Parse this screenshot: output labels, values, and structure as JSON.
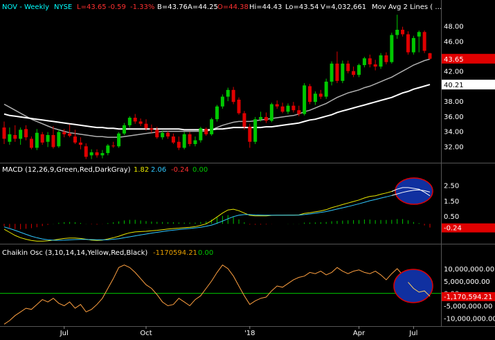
{
  "chart_data": [
    {
      "type": "candlestick",
      "panel": "price",
      "header": {
        "symbol": "NOV - Weekly",
        "exchange": "NYSE",
        "last": "L=43.65",
        "change": "-0.59",
        "change_pct": "-1.33%",
        "bid": "B=43.76",
        "ask": "A=44.25",
        "open": "O=44.38",
        "high": "Hi=44.43",
        "low": "Lo=43.54",
        "volume": "V=4,032,661",
        "study": "Mov Avg 2 Lines ( ..."
      },
      "y_ticks": [
        "48.00",
        "46.00",
        "44.00",
        "42.00",
        "40.00",
        "38.00",
        "36.00",
        "34.00",
        "32.00"
      ],
      "ylim": [
        30,
        49.8
      ],
      "price_tag": "43.65",
      "ma_tag": "40.21",
      "x_labels": [
        "Jul",
        "Oct",
        "'18",
        "Apr",
        "Jul"
      ],
      "candles": [
        {
          "o": 34.5,
          "h": 35.3,
          "l": 32.3,
          "c": 33.0
        },
        {
          "o": 32.6,
          "h": 34.5,
          "l": 32.2,
          "c": 33.6
        },
        {
          "o": 33.5,
          "h": 34.8,
          "l": 32.6,
          "c": 33.0
        },
        {
          "o": 33.0,
          "h": 34.5,
          "l": 32.2,
          "c": 34.2
        },
        {
          "o": 34.3,
          "h": 34.8,
          "l": 32.8,
          "c": 33.2
        },
        {
          "o": 33.0,
          "h": 33.3,
          "l": 31.6,
          "c": 31.8
        },
        {
          "o": 31.8,
          "h": 34.3,
          "l": 31.5,
          "c": 33.8
        },
        {
          "o": 33.6,
          "h": 33.9,
          "l": 32.2,
          "c": 32.5
        },
        {
          "o": 32.6,
          "h": 33.9,
          "l": 31.9,
          "c": 33.5
        },
        {
          "o": 33.5,
          "h": 34.7,
          "l": 31.7,
          "c": 31.9
        },
        {
          "o": 32.0,
          "h": 34.2,
          "l": 31.8,
          "c": 33.9
        },
        {
          "o": 33.9,
          "h": 34.3,
          "l": 33.2,
          "c": 33.6
        },
        {
          "o": 33.7,
          "h": 34.9,
          "l": 33.2,
          "c": 33.4
        },
        {
          "o": 33.3,
          "h": 34.2,
          "l": 32.3,
          "c": 32.5
        },
        {
          "o": 32.5,
          "h": 33.2,
          "l": 31.6,
          "c": 32.2
        },
        {
          "o": 32.0,
          "h": 32.4,
          "l": 30.3,
          "c": 30.6
        },
        {
          "o": 30.8,
          "h": 31.6,
          "l": 30.3,
          "c": 31.2
        },
        {
          "o": 31.2,
          "h": 31.6,
          "l": 30.5,
          "c": 30.8
        },
        {
          "o": 30.8,
          "h": 31.5,
          "l": 30.4,
          "c": 31.1
        },
        {
          "o": 31.1,
          "h": 32.3,
          "l": 30.8,
          "c": 32.1
        },
        {
          "o": 32.1,
          "h": 32.6,
          "l": 31.8,
          "c": 32.0
        },
        {
          "o": 32.0,
          "h": 33.9,
          "l": 31.8,
          "c": 33.7
        },
        {
          "o": 33.7,
          "h": 35.1,
          "l": 33.5,
          "c": 34.8
        },
        {
          "o": 34.8,
          "h": 36.0,
          "l": 34.5,
          "c": 35.8
        },
        {
          "o": 35.8,
          "h": 36.3,
          "l": 35.0,
          "c": 35.3
        },
        {
          "o": 35.3,
          "h": 35.7,
          "l": 34.7,
          "c": 35.0
        },
        {
          "o": 35.0,
          "h": 35.6,
          "l": 34.1,
          "c": 34.4
        },
        {
          "o": 34.4,
          "h": 34.9,
          "l": 33.8,
          "c": 34.2
        },
        {
          "o": 34.2,
          "h": 34.6,
          "l": 33.0,
          "c": 33.2
        },
        {
          "o": 33.2,
          "h": 34.1,
          "l": 32.9,
          "c": 33.8
        },
        {
          "o": 33.8,
          "h": 34.0,
          "l": 33.0,
          "c": 33.3
        },
        {
          "o": 33.3,
          "h": 33.7,
          "l": 32.3,
          "c": 32.5
        },
        {
          "o": 32.6,
          "h": 33.3,
          "l": 31.5,
          "c": 31.8
        },
        {
          "o": 31.8,
          "h": 33.9,
          "l": 31.6,
          "c": 33.6
        },
        {
          "o": 33.6,
          "h": 33.9,
          "l": 32.0,
          "c": 32.3
        },
        {
          "o": 32.3,
          "h": 33.3,
          "l": 32.0,
          "c": 32.8
        },
        {
          "o": 32.8,
          "h": 34.6,
          "l": 32.5,
          "c": 34.4
        },
        {
          "o": 34.3,
          "h": 34.5,
          "l": 33.4,
          "c": 33.6
        },
        {
          "o": 33.6,
          "h": 35.8,
          "l": 33.4,
          "c": 35.6
        },
        {
          "o": 35.6,
          "h": 37.5,
          "l": 35.3,
          "c": 37.3
        },
        {
          "o": 37.3,
          "h": 38.9,
          "l": 37.0,
          "c": 38.6
        },
        {
          "o": 38.6,
          "h": 39.8,
          "l": 38.0,
          "c": 39.5
        },
        {
          "o": 39.5,
          "h": 39.9,
          "l": 37.6,
          "c": 37.9
        },
        {
          "o": 38.2,
          "h": 38.5,
          "l": 36.2,
          "c": 36.4
        },
        {
          "o": 36.4,
          "h": 36.7,
          "l": 34.2,
          "c": 34.6
        },
        {
          "o": 34.6,
          "h": 35.0,
          "l": 31.8,
          "c": 32.6
        },
        {
          "o": 32.6,
          "h": 35.9,
          "l": 32.3,
          "c": 35.6
        },
        {
          "o": 35.6,
          "h": 36.6,
          "l": 35.3,
          "c": 35.9
        },
        {
          "o": 35.9,
          "h": 36.5,
          "l": 35.1,
          "c": 35.4
        },
        {
          "o": 35.4,
          "h": 37.8,
          "l": 35.2,
          "c": 37.6
        },
        {
          "o": 37.6,
          "h": 38.1,
          "l": 37.0,
          "c": 37.3
        },
        {
          "o": 37.3,
          "h": 37.8,
          "l": 36.4,
          "c": 36.6
        },
        {
          "o": 36.6,
          "h": 37.7,
          "l": 36.3,
          "c": 37.4
        },
        {
          "o": 37.4,
          "h": 37.9,
          "l": 36.5,
          "c": 36.8
        },
        {
          "o": 36.8,
          "h": 37.4,
          "l": 36.0,
          "c": 36.3
        },
        {
          "o": 36.3,
          "h": 40.4,
          "l": 36.1,
          "c": 40.1
        },
        {
          "o": 40.0,
          "h": 40.3,
          "l": 37.6,
          "c": 37.9
        },
        {
          "o": 37.9,
          "h": 39.3,
          "l": 37.5,
          "c": 39.0
        },
        {
          "o": 39.0,
          "h": 39.5,
          "l": 38.3,
          "c": 38.6
        },
        {
          "o": 38.6,
          "h": 41.0,
          "l": 38.3,
          "c": 40.6
        },
        {
          "o": 40.6,
          "h": 43.3,
          "l": 40.1,
          "c": 43.0
        },
        {
          "o": 43.0,
          "h": 44.6,
          "l": 40.4,
          "c": 40.7
        },
        {
          "o": 40.7,
          "h": 43.4,
          "l": 40.4,
          "c": 43.0
        },
        {
          "o": 43.0,
          "h": 43.4,
          "l": 41.7,
          "c": 42.0
        },
        {
          "o": 42.0,
          "h": 42.6,
          "l": 41.2,
          "c": 41.5
        },
        {
          "o": 41.5,
          "h": 43.0,
          "l": 41.2,
          "c": 42.8
        },
        {
          "o": 42.8,
          "h": 43.9,
          "l": 42.5,
          "c": 43.7
        },
        {
          "o": 43.7,
          "h": 44.2,
          "l": 42.5,
          "c": 42.9
        },
        {
          "o": 42.9,
          "h": 43.5,
          "l": 42.1,
          "c": 42.6
        },
        {
          "o": 42.6,
          "h": 44.4,
          "l": 42.3,
          "c": 44.1
        },
        {
          "o": 44.1,
          "h": 44.5,
          "l": 42.9,
          "c": 43.2
        },
        {
          "o": 43.2,
          "h": 47.1,
          "l": 43.0,
          "c": 46.8
        },
        {
          "o": 46.8,
          "h": 49.5,
          "l": 46.3,
          "c": 47.5
        },
        {
          "o": 47.5,
          "h": 47.9,
          "l": 46.6,
          "c": 46.9
        },
        {
          "o": 46.9,
          "h": 47.3,
          "l": 44.2,
          "c": 44.5
        },
        {
          "o": 44.5,
          "h": 46.7,
          "l": 44.2,
          "c": 46.4
        },
        {
          "o": 46.6,
          "h": 47.4,
          "l": 44.5,
          "c": 47.2
        },
        {
          "o": 47.2,
          "h": 47.4,
          "l": 44.4,
          "c": 44.7
        },
        {
          "o": 44.38,
          "h": 44.43,
          "l": 43.54,
          "c": 43.65
        }
      ],
      "series": [
        {
          "name": "MA1",
          "color": "#b0b0b0",
          "values": [
            37.6,
            37.2,
            36.8,
            36.4,
            36.0,
            35.6,
            35.3,
            35.0,
            34.7,
            34.4,
            34.2,
            34.0,
            33.8,
            33.7,
            33.6,
            33.5,
            33.4,
            33.3,
            33.3,
            33.2,
            33.2,
            33.2,
            33.3,
            33.4,
            33.5,
            33.6,
            33.7,
            33.8,
            33.9,
            34.0,
            34.0,
            34.0,
            34.0,
            34.0,
            34.0,
            34.0,
            34.0,
            34.0,
            34.2,
            34.5,
            34.8,
            35.0,
            35.2,
            35.3,
            35.3,
            35.3,
            35.4,
            35.5,
            35.6,
            35.7,
            35.8,
            35.9,
            36.0,
            36.1,
            36.3,
            36.6,
            36.8,
            37.1,
            37.4,
            37.7,
            38.1,
            38.5,
            38.8,
            39.1,
            39.3,
            39.5,
            39.8,
            40.0,
            40.3,
            40.6,
            40.9,
            41.2,
            41.6,
            42.0,
            42.4,
            42.8,
            43.1,
            43.4,
            43.6
          ]
        },
        {
          "name": "MA2",
          "color": "#ffffff",
          "values": [
            36.3,
            36.1,
            36.0,
            35.9,
            35.8,
            35.7,
            35.6,
            35.5,
            35.4,
            35.3,
            35.2,
            35.1,
            35.0,
            34.9,
            34.8,
            34.7,
            34.6,
            34.5,
            34.5,
            34.4,
            34.4,
            34.3,
            34.3,
            34.3,
            34.3,
            34.3,
            34.3,
            34.3,
            34.3,
            34.3,
            34.3,
            34.3,
            34.3,
            34.2,
            34.2,
            34.2,
            34.2,
            34.2,
            34.2,
            34.3,
            34.3,
            34.4,
            34.5,
            34.5,
            34.5,
            34.5,
            34.5,
            34.5,
            34.6,
            34.6,
            34.7,
            34.8,
            34.9,
            35.0,
            35.1,
            35.3,
            35.5,
            35.6,
            35.8,
            36.0,
            36.2,
            36.5,
            36.7,
            36.9,
            37.1,
            37.3,
            37.5,
            37.7,
            37.9,
            38.1,
            38.3,
            38.5,
            38.8,
            39.1,
            39.3,
            39.6,
            39.8,
            40.0,
            40.21
          ]
        }
      ],
      "colors": {
        "up": "#00c800",
        "down": "#e00000",
        "bg": "#000000"
      }
    },
    {
      "type": "line",
      "panel": "macd",
      "label": "MACD (12,26,9,Green,Red,DarkGray)",
      "values_text": [
        "1.82",
        "2.06",
        "-0.24",
        "0.00"
      ],
      "y_ticks": [
        "2.50",
        "1.50",
        "0.50"
      ],
      "ylim": [
        -1.2,
        3.2
      ],
      "tag": "-0.24",
      "series": [
        {
          "name": "MACD",
          "color": "#e8e800",
          "values": [
            -0.35,
            -0.55,
            -0.75,
            -0.9,
            -1.0,
            -1.08,
            -1.12,
            -1.12,
            -1.1,
            -1.05,
            -1.0,
            -0.95,
            -0.92,
            -0.92,
            -0.95,
            -1.0,
            -1.05,
            -1.08,
            -1.05,
            -0.98,
            -0.9,
            -0.8,
            -0.68,
            -0.58,
            -0.52,
            -0.5,
            -0.48,
            -0.45,
            -0.42,
            -0.38,
            -0.34,
            -0.3,
            -0.28,
            -0.25,
            -0.22,
            -0.18,
            -0.1,
            0.0,
            0.2,
            0.45,
            0.7,
            0.9,
            0.95,
            0.85,
            0.7,
            0.55,
            0.52,
            0.52,
            0.52,
            0.55,
            0.56,
            0.56,
            0.57,
            0.57,
            0.58,
            0.68,
            0.72,
            0.78,
            0.84,
            0.92,
            1.05,
            1.15,
            1.25,
            1.35,
            1.45,
            1.55,
            1.68,
            1.78,
            1.82,
            1.92,
            2.0,
            2.1,
            2.25,
            2.35,
            2.35,
            2.3,
            2.25,
            2.05,
            1.82
          ]
        },
        {
          "name": "Signal",
          "color": "#30c8ff",
          "values": [
            -0.2,
            -0.3,
            -0.42,
            -0.55,
            -0.68,
            -0.8,
            -0.9,
            -0.98,
            -1.03,
            -1.06,
            -1.07,
            -1.06,
            -1.04,
            -1.02,
            -1.01,
            -1.01,
            -1.02,
            -1.03,
            -1.04,
            -1.03,
            -1.0,
            -0.96,
            -0.9,
            -0.84,
            -0.78,
            -0.72,
            -0.66,
            -0.6,
            -0.55,
            -0.5,
            -0.45,
            -0.41,
            -0.37,
            -0.33,
            -0.3,
            -0.26,
            -0.22,
            -0.16,
            -0.08,
            0.04,
            0.18,
            0.33,
            0.47,
            0.56,
            0.6,
            0.6,
            0.58,
            0.57,
            0.56,
            0.56,
            0.56,
            0.56,
            0.56,
            0.56,
            0.57,
            0.6,
            0.64,
            0.69,
            0.74,
            0.8,
            0.88,
            0.96,
            1.04,
            1.12,
            1.21,
            1.3,
            1.4,
            1.5,
            1.58,
            1.67,
            1.75,
            1.84,
            1.94,
            2.04,
            2.12,
            2.18,
            2.2,
            2.15,
            2.06
          ]
        }
      ],
      "histogram": [
        -0.15,
        -0.25,
        -0.33,
        -0.35,
        -0.32,
        -0.28,
        -0.22,
        -0.14,
        -0.07,
        0.01,
        0.07,
        0.11,
        0.12,
        0.1,
        0.06,
        0.01,
        -0.03,
        -0.05,
        -0.01,
        0.05,
        0.1,
        0.16,
        0.22,
        0.26,
        0.26,
        0.22,
        0.18,
        0.15,
        0.13,
        0.12,
        0.11,
        0.11,
        0.09,
        0.08,
        0.08,
        0.08,
        0.12,
        0.16,
        0.28,
        0.41,
        0.52,
        0.57,
        0.48,
        0.29,
        0.1,
        -0.05,
        -0.06,
        -0.05,
        -0.04,
        -0.01,
        0.0,
        0.0,
        0.01,
        0.01,
        0.01,
        0.08,
        0.08,
        0.09,
        0.1,
        0.12,
        0.17,
        0.19,
        0.21,
        0.23,
        0.24,
        0.25,
        0.28,
        0.28,
        0.24,
        0.25,
        0.25,
        0.26,
        0.31,
        0.31,
        0.23,
        0.12,
        0.05,
        -0.1,
        -0.24
      ],
      "colors": {
        "pos": "#00c800",
        "neg": "#e00000"
      }
    },
    {
      "type": "line",
      "panel": "chaikin",
      "label": "Chaikin Osc (3,10,14,14,Yellow,Red,Black)",
      "values_text": [
        "-1170594.21",
        "0.00"
      ],
      "y_ticks": [
        "10,000,000.00",
        "5,000,000.00",
        "0.00",
        "-5,000,000.00",
        "-10,000,000.00"
      ],
      "ylim": [
        -13000000,
        14500000
      ],
      "tag": "-1,170,594.21",
      "series": [
        {
          "name": "Chaikin",
          "color": "#ffa040",
          "values": [
            -12500000,
            -11000000,
            -9000000,
            -7500000,
            -6000000,
            -6500000,
            -4500000,
            -2500000,
            -3500000,
            -2000000,
            -4000000,
            -5000000,
            -3500000,
            -6000000,
            -4500000,
            -7500000,
            -6500000,
            -4500000,
            -2000000,
            2000000,
            6000000,
            10500000,
            11500000,
            10500000,
            8500000,
            6000000,
            3500000,
            2000000,
            -500000,
            -3500000,
            -5000000,
            -4500000,
            -2000000,
            -3500000,
            -5000000,
            -2500000,
            -1000000,
            2000000,
            5000000,
            8500000,
            11500000,
            10000000,
            7000000,
            3000000,
            -1000000,
            -4500000,
            -3000000,
            -2000000,
            -1500000,
            1000000,
            3000000,
            2500000,
            4000000,
            5500000,
            6500000,
            7000000,
            8500000,
            8000000,
            9000000,
            7500000,
            8500000,
            10500000,
            9000000,
            8000000,
            9000000,
            9500000,
            8500000,
            8000000,
            9000000,
            7500000,
            5500000,
            8000000,
            10000000,
            7500000,
            4500000,
            2000000,
            500000,
            1000000,
            -1170594
          ]
        },
        {
          "name": "Zero",
          "color": "#00c800",
          "values": [
            0
          ]
        }
      ]
    }
  ],
  "annotations": [
    {
      "name": "macd-highlight-ellipse",
      "color": "#1030a0"
    },
    {
      "name": "chaikin-highlight-ellipse",
      "color": "#1030a0"
    }
  ]
}
